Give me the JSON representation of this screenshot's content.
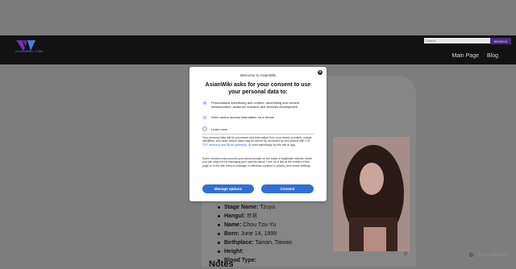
{
  "site": {
    "logo_text": "ASIANWIKI.COM",
    "search": {
      "placeholder": "Search",
      "button_label": "SEARCH"
    },
    "nav": [
      "Main Page",
      "Blog"
    ]
  },
  "profile": {
    "fields": [
      {
        "label": "Stage Name:",
        "value": "Tzuyu"
      },
      {
        "label": "Hangul:",
        "value": "쯔위"
      },
      {
        "label": "Name:",
        "value": "Chou Tzu-Yu"
      },
      {
        "label": "Born:",
        "value": "June 14, 1999"
      },
      {
        "label": "Birthplace:",
        "value": "Tainan, Taiwan"
      },
      {
        "label": "Height:",
        "value": ""
      },
      {
        "label": "Blood Type:",
        "value": ""
      }
    ],
    "image_caption": "Zl",
    "notes_heading": "Notes"
  },
  "consent_modal": {
    "close_icon": "close-icon",
    "welcome": "Welcome to AsianWiki",
    "title": "AsianWiki asks for your consent to use your personal data to:",
    "purposes": [
      {
        "icon": "person-icon",
        "text": "Personalised advertising and content, advertising and content measurement, audience research and services development"
      },
      {
        "icon": "device-icon",
        "text": "Store and/or access information on a device"
      }
    ],
    "learn_more": "Learn more",
    "paragraph1_a": "Your personal data will be processed and information from your device (cookies, unique identifiers, and other device data) may be stored by, accessed by and shared with ",
    "paragraph1_link": "128 TCF vendor(s) and 68 ad partner(s)",
    "paragraph1_b": ", or used specifically by this site or app.",
    "paragraph2": "Some vendors may process your personal data on the basis of legitimate interest, which you can object to by managing your options below. Look for a link at the bottom of this page or in the site menu to manage or withdraw consent in privacy and cookie settings.",
    "manage_button": "Manage options",
    "consent_button": "Consent"
  },
  "watermark": {
    "text": "Scan Malware"
  },
  "colors": {
    "accent": "#2f6fd5",
    "header": "#121212",
    "overlay": "#7d7d7d"
  }
}
